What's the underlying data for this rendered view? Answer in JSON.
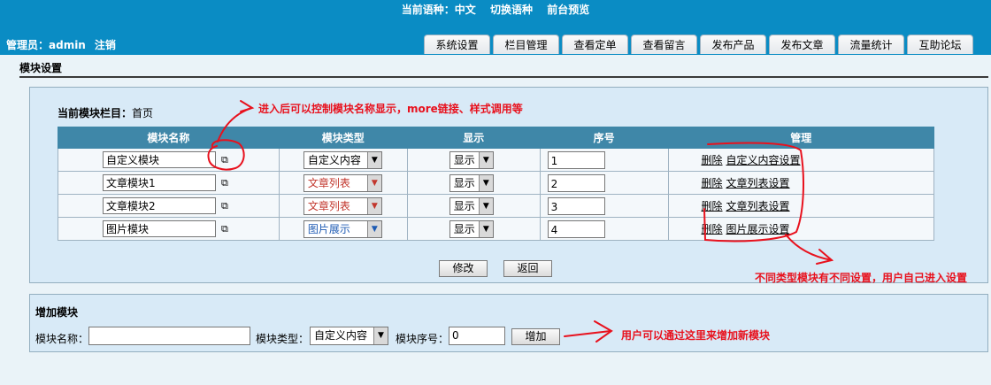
{
  "header": {
    "current_lang_label": "当前语种：中文",
    "switch_lang": "切换语种",
    "preview": "前台预览",
    "admin_label": "管理员：admin",
    "logout": "注销",
    "tabs": [
      "系统设置",
      "栏目管理",
      "查看定单",
      "查看留言",
      "发布产品",
      "发布文章",
      "流量统计",
      "互助论坛"
    ]
  },
  "page": {
    "title": "模块设置"
  },
  "current_column": {
    "label": "当前模块栏目：",
    "value": "首页"
  },
  "table": {
    "headers": [
      "模块名称",
      "模块类型",
      "显示",
      "序号",
      "管理"
    ],
    "rows": [
      {
        "name": "自定义模块",
        "type": "自定义内容",
        "show": "显示",
        "order": "1",
        "delete": "删除",
        "setting": "自定义内容设置"
      },
      {
        "name": "文章模块1",
        "type": "文章列表",
        "show": "显示",
        "order": "2",
        "delete": "删除",
        "setting": "文章列表设置"
      },
      {
        "name": "文章模块2",
        "type": "文章列表",
        "show": "显示",
        "order": "3",
        "delete": "删除",
        "setting": "文章列表设置"
      },
      {
        "name": "图片模块",
        "type": "图片展示",
        "show": "显示",
        "order": "4",
        "delete": "删除",
        "setting": "图片展示设置"
      }
    ]
  },
  "buttons": {
    "edit": "修改",
    "back": "返回",
    "add": "增加"
  },
  "add_module": {
    "title": "增加模块",
    "name_label": "模块名称：",
    "name_value": "",
    "type_label": "模块类型：",
    "type_value": "自定义内容",
    "order_label": "模块序号：",
    "order_value": "0"
  },
  "annotations": {
    "a1": "进入后可以控制模块名称显示，more链接、样式调用等",
    "a2": "不同类型模块有不同设置，用户自己进入设置",
    "a3": "用户可以通过这里来增加新模块"
  },
  "colors": {
    "header_bg": "#0a8cc4",
    "table_header": "#3f87a8",
    "panel_bg": "#d8eaf7",
    "annotation": "#e8111d",
    "type_red": "#c2362c",
    "type_blue": "#1e5bb3"
  }
}
